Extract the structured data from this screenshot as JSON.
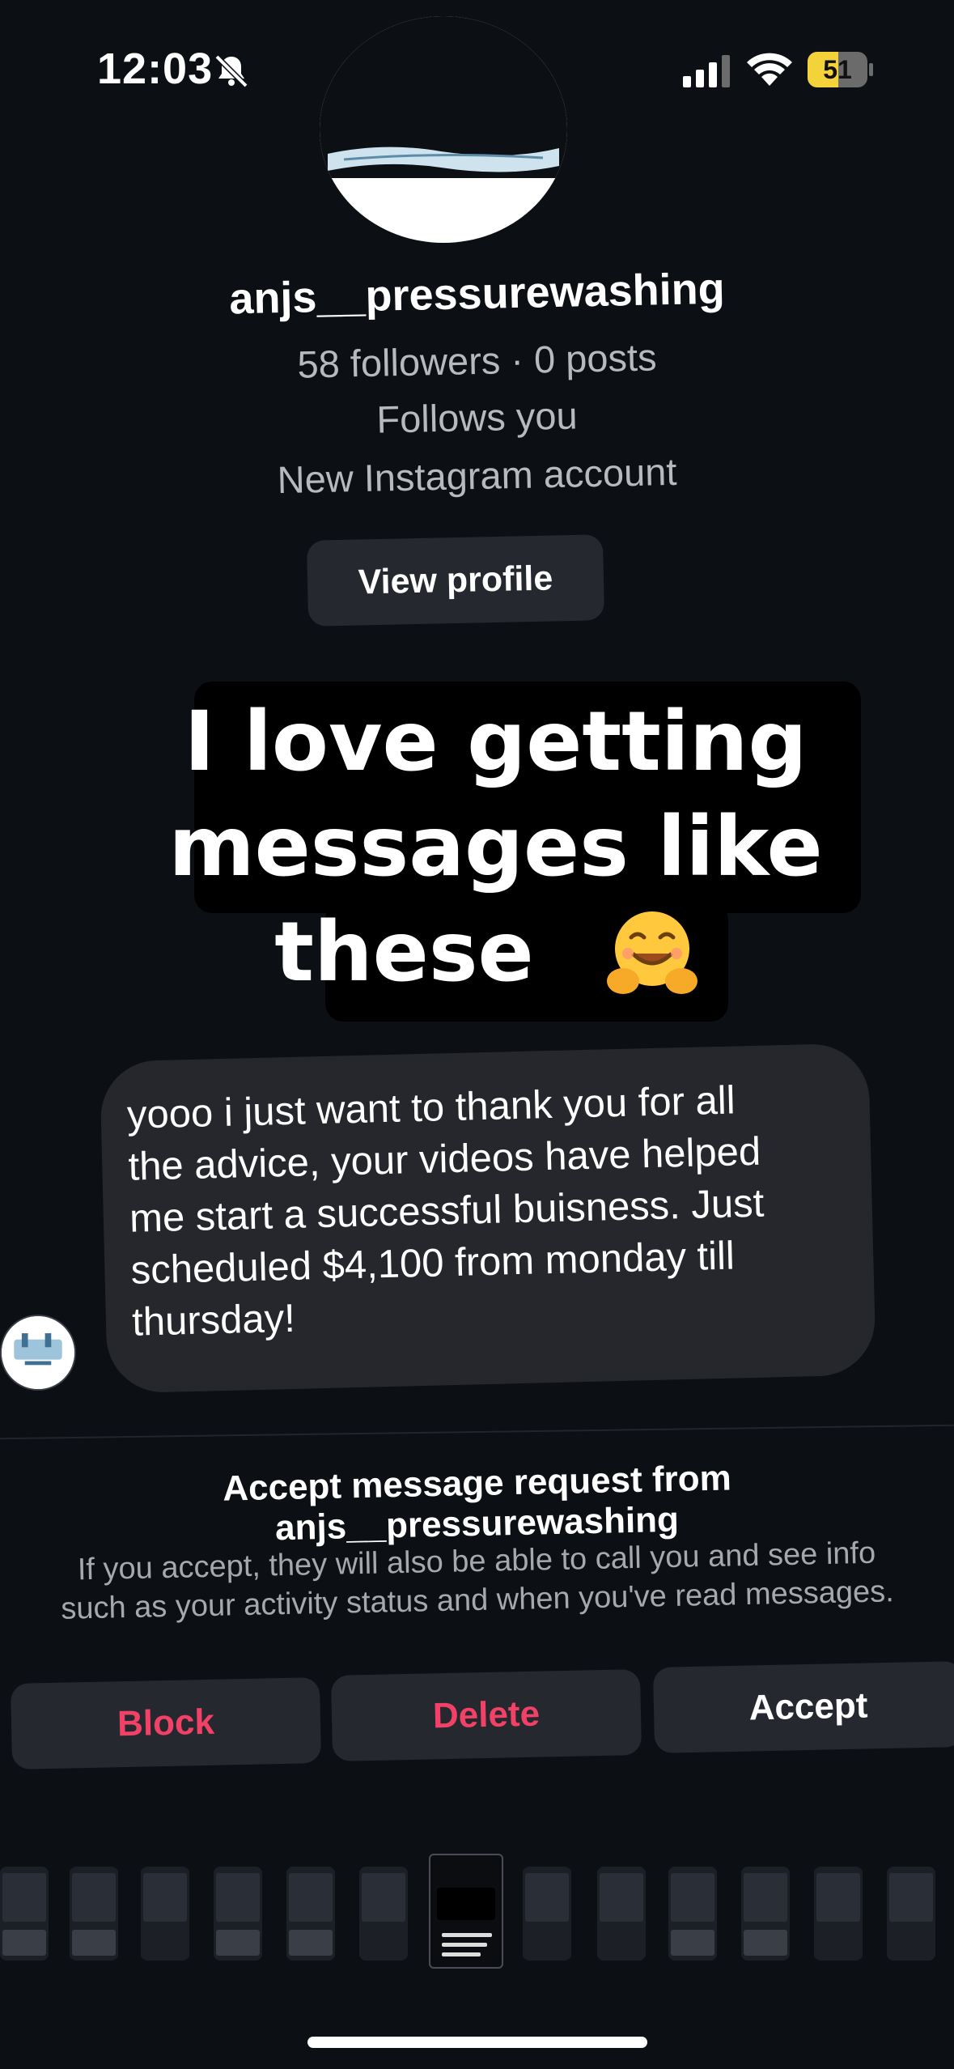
{
  "status_bar": {
    "time": "12:03",
    "battery_level": "51",
    "icons": [
      "bell-slash-icon",
      "cellular-signal-icon",
      "wifi-icon",
      "battery-icon"
    ]
  },
  "profile": {
    "username": "anjs__pressurewashing",
    "stats": "58 followers · 0 posts",
    "follows_you": "Follows you",
    "account_note": "New Instagram account",
    "view_profile_label": "View profile"
  },
  "caption": {
    "line1": "I love getting",
    "line2": "messages like",
    "line3": "these",
    "emoji": "hugging-face-emoji"
  },
  "message": {
    "lines": [
      "yooo i just want to thank you for all",
      "the advice, your videos have helped",
      "me start a successful buisness. Just",
      "scheduled $4,100 from monday till",
      "thursday!"
    ]
  },
  "request": {
    "title_line1": "Accept message request from",
    "title_line2": "anjs__pressurewashing",
    "desc_line1": "If you accept, they will also be able to call you and see info",
    "desc_line2": "such as your activity status and when you've read messages.",
    "block_label": "Block",
    "delete_label": "Delete",
    "accept_label": "Accept"
  },
  "colors": {
    "background": "#0c0f14",
    "button_bg": "#25282f",
    "destructive": "#f24167",
    "battery": "#f3d23a"
  }
}
